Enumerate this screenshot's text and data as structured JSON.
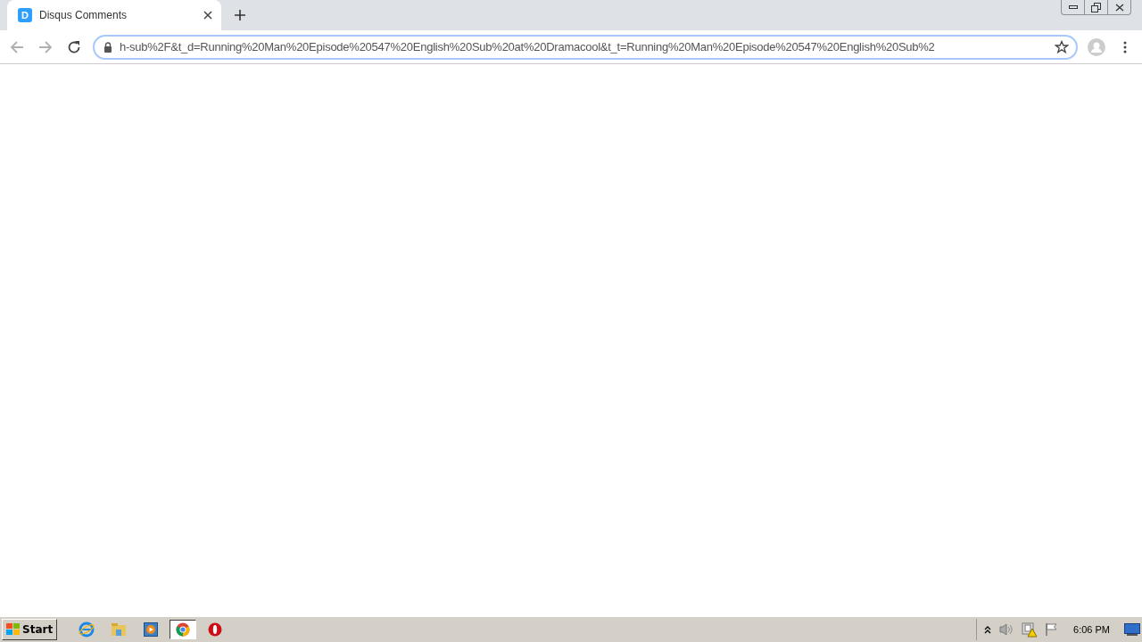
{
  "browser": {
    "tabs": [
      {
        "title": "Disqus Comments",
        "favicon": "D",
        "selected": true
      }
    ],
    "address": "h-sub%2F&t_d=Running%20Man%20Episode%20547%20English%20Sub%20at%20Dramacool&t_t=Running%20Man%20Episode%20547%20English%20Sub%2"
  },
  "taskbar": {
    "start": "Start",
    "apps": [
      {
        "kind": "ie",
        "selected": false
      },
      {
        "kind": "folder",
        "selected": false
      },
      {
        "kind": "media",
        "selected": false
      },
      {
        "kind": "chrome",
        "selected": true
      },
      {
        "kind": "opera",
        "selected": false
      }
    ],
    "clock": "6:06 PM"
  }
}
